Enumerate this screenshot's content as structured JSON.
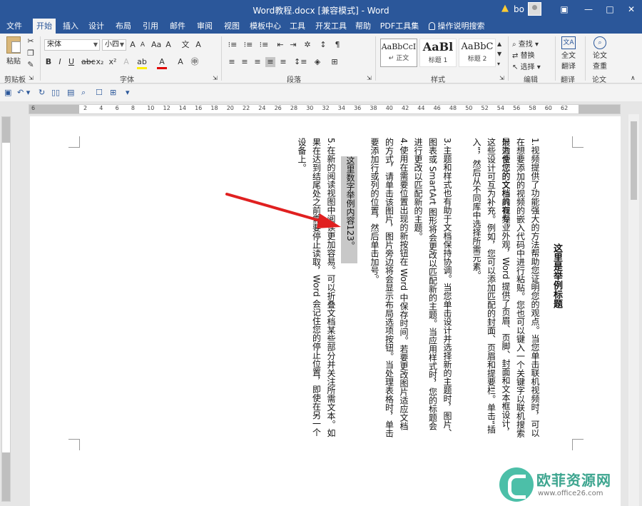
{
  "window": {
    "title": "Word教程.docx [兼容模式] - Word",
    "user": "bo",
    "minimize": "—",
    "restore": "▢",
    "maximize": "□",
    "close": "✕"
  },
  "tabs": [
    "文件",
    "开始",
    "插入",
    "设计",
    "布局",
    "引用",
    "邮件",
    "审阅",
    "视图",
    "模板中心",
    "工具",
    "开发工具",
    "帮助",
    "PDF工具集",
    "操作说明搜索"
  ],
  "ribbon": {
    "clipboard": {
      "paste": "粘贴",
      "group": "剪贴板"
    },
    "font": {
      "name": "宋体",
      "size": "小四",
      "group": "字体"
    },
    "paragraph": {
      "group": "段落"
    },
    "styles": {
      "group": "样式",
      "items": [
        {
          "sample": "AaBbCcI",
          "name": "↵ 正文"
        },
        {
          "sample": "AaBl",
          "name": "标题 1"
        },
        {
          "sample": "AaBbC",
          "name": "标题 2"
        }
      ]
    },
    "editing": {
      "find": "查找",
      "replace": "替换",
      "select": "选择",
      "group": "编辑"
    },
    "translate": {
      "label1": "全文",
      "label2": "翻译",
      "group": "翻译"
    },
    "paper": {
      "label1": "论文",
      "label2": "查重",
      "group": "论文"
    }
  },
  "ruler": {
    "left_num": "6",
    "right_nums": [
      "2",
      "4",
      "6",
      "8",
      "10",
      "12",
      "14",
      "16",
      "18",
      "20",
      "22",
      "24",
      "26",
      "28",
      "30",
      "32",
      "34",
      "36",
      "38",
      "40",
      "42",
      "44",
      "46",
      "48",
      "50",
      "52",
      "54",
      "56",
      "58",
      "60",
      "62"
    ],
    "end_nums": [
      "60",
      "62"
    ]
  },
  "document": {
    "title": "这里是举例标题",
    "p1": "1.视频提供了功能强大的方法帮助您证明您的观点。当您单击联机视频时，可以在想要添加的视频的嵌入代码中进行粘贴。您也可以键入一个关键字以联机搜索最适合您的文档的视频。",
    "p2": "2.为使您的文档具有专业外观，Word 提供了页眉、页脚、封面和文本框设计，这些设计可互为补充。例如，您可以添加匹配的封面、页眉和提要栏。单击“插入”，然后从不同库中选择所需元素。",
    "p3": "3.主题和样式也有助于文档保持协调。当您单击设计并选择新的主题时，图片、图表或 SmartArt 图形将会更改以匹配新的主题。当应用样式时，您的标题会进行更改以匹配新的主题。",
    "p4": "4.使用在需要位置出现的新按钮在 Word 中保存时间。若要更改图片适应文档的方式，请单击该图片，图片旁边将会显示布局选项按钮。当处理表格时，单击要添加行或列的位置，然后单击加号。",
    "selected": "这里数字举例内容123。",
    "p5": "5.在新的阅读视图中阅读更加容易。可以折叠文档某些部分并关注所需文本。如果在达到结尾处之前需要停止读取，Word 会记住您的停止位置，即使在另一个设备上。"
  },
  "watermark": {
    "brand": "欧菲资源网",
    "url": "www.office26.com"
  }
}
